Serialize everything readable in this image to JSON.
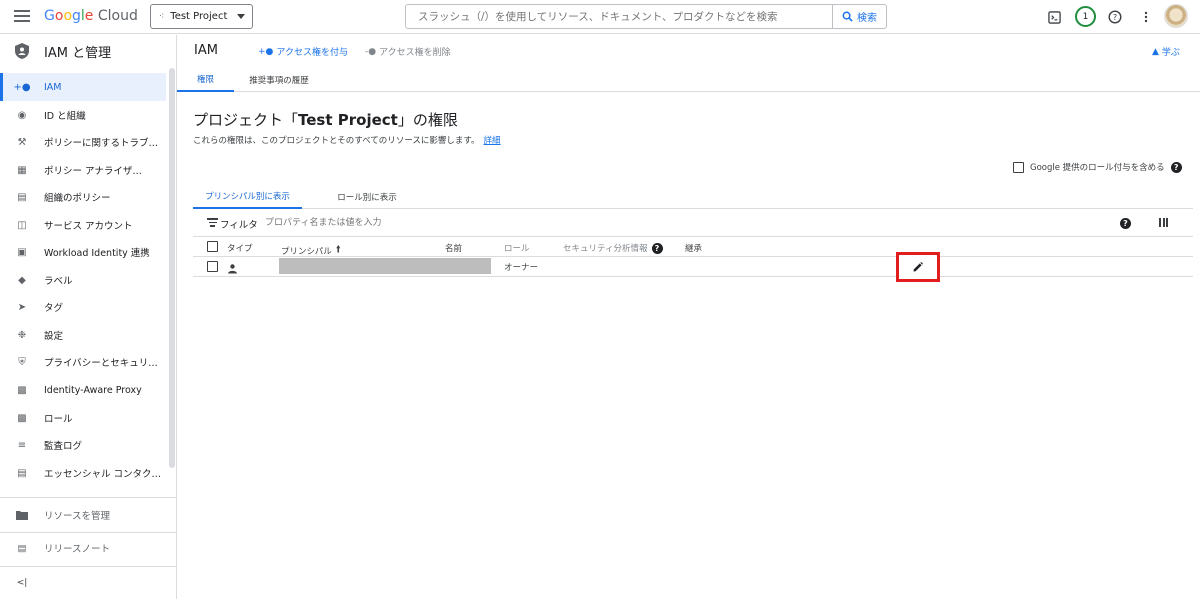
{
  "header": {
    "logo_parts": [
      "G",
      "o",
      "o",
      "g",
      "l",
      "e"
    ],
    "logo_suffix": "Cloud",
    "project": "Test Project",
    "search_placeholder": "スラッシュ（/）を使用してリソース、ドキュメント、プロダクトなどを検索",
    "search_button": "検索",
    "notification_count": "1",
    "icons": [
      "menu-icon",
      "cloud-shell-icon",
      "help-icon",
      "more-vert-icon",
      "avatar"
    ]
  },
  "sidebar": {
    "title": "IAM と管理",
    "items": [
      {
        "label": "IAM",
        "icon": "person-add-icon",
        "active": true
      },
      {
        "label": "ID と組織",
        "icon": "account-circle-icon"
      },
      {
        "label": "ポリシーに関するトラブ…",
        "icon": "wrench-icon"
      },
      {
        "label": "ポリシー アナライザ…",
        "icon": "policy-analyzer-icon"
      },
      {
        "label": "組織のポリシー",
        "icon": "list-alt-icon"
      },
      {
        "label": "サービス アカウント",
        "icon": "service-account-icon"
      },
      {
        "label": "Workload Identity 連携",
        "icon": "badge-icon"
      },
      {
        "label": "ラベル",
        "icon": "label-icon"
      },
      {
        "label": "タグ",
        "icon": "tag-icon"
      },
      {
        "label": "設定",
        "icon": "settings-icon"
      },
      {
        "label": "プライバシーとセキュリ…",
        "icon": "shield-icon"
      },
      {
        "label": "Identity-Aware Proxy",
        "icon": "iap-icon"
      },
      {
        "label": "ロール",
        "icon": "roles-icon"
      },
      {
        "label": "監査ログ",
        "icon": "audit-log-icon"
      },
      {
        "label": "エッセンシャル コンタク…",
        "icon": "contacts-icon"
      }
    ],
    "bottom": [
      {
        "label": "リソースを管理",
        "icon": "folder-icon"
      },
      {
        "label": "リリースノート",
        "icon": "release-notes-icon"
      }
    ],
    "collapse_icon": "<|"
  },
  "main": {
    "title": "IAM",
    "grant_access": "アクセス権を付与",
    "remove_access": "アクセス権を削除",
    "learn": "学ぶ",
    "tabs": [
      "権限",
      "推奨事項の履歴"
    ],
    "page_title_prefix": "プロジェクト「",
    "page_title_project": "Test Project",
    "page_title_suffix": "」の権限",
    "description": "これらの権限は、このプロジェクトとそのすべてのリソースに影響します。",
    "details_link": "詳細",
    "include_google_roles": "Google 提供のロール付与を含める",
    "view_tabs": [
      "プリンシパル別に表示",
      "ロール別に表示"
    ],
    "filter_label": "フィルタ",
    "filter_placeholder": "プロパティ名または値を入力",
    "columns": [
      "タイプ",
      "プリンシパル",
      "名前",
      "ロール",
      "セキュリティ分析情報",
      "継承"
    ],
    "rows": [
      {
        "type": "person",
        "principal": "",
        "name": "",
        "role": "オーナー"
      }
    ]
  }
}
